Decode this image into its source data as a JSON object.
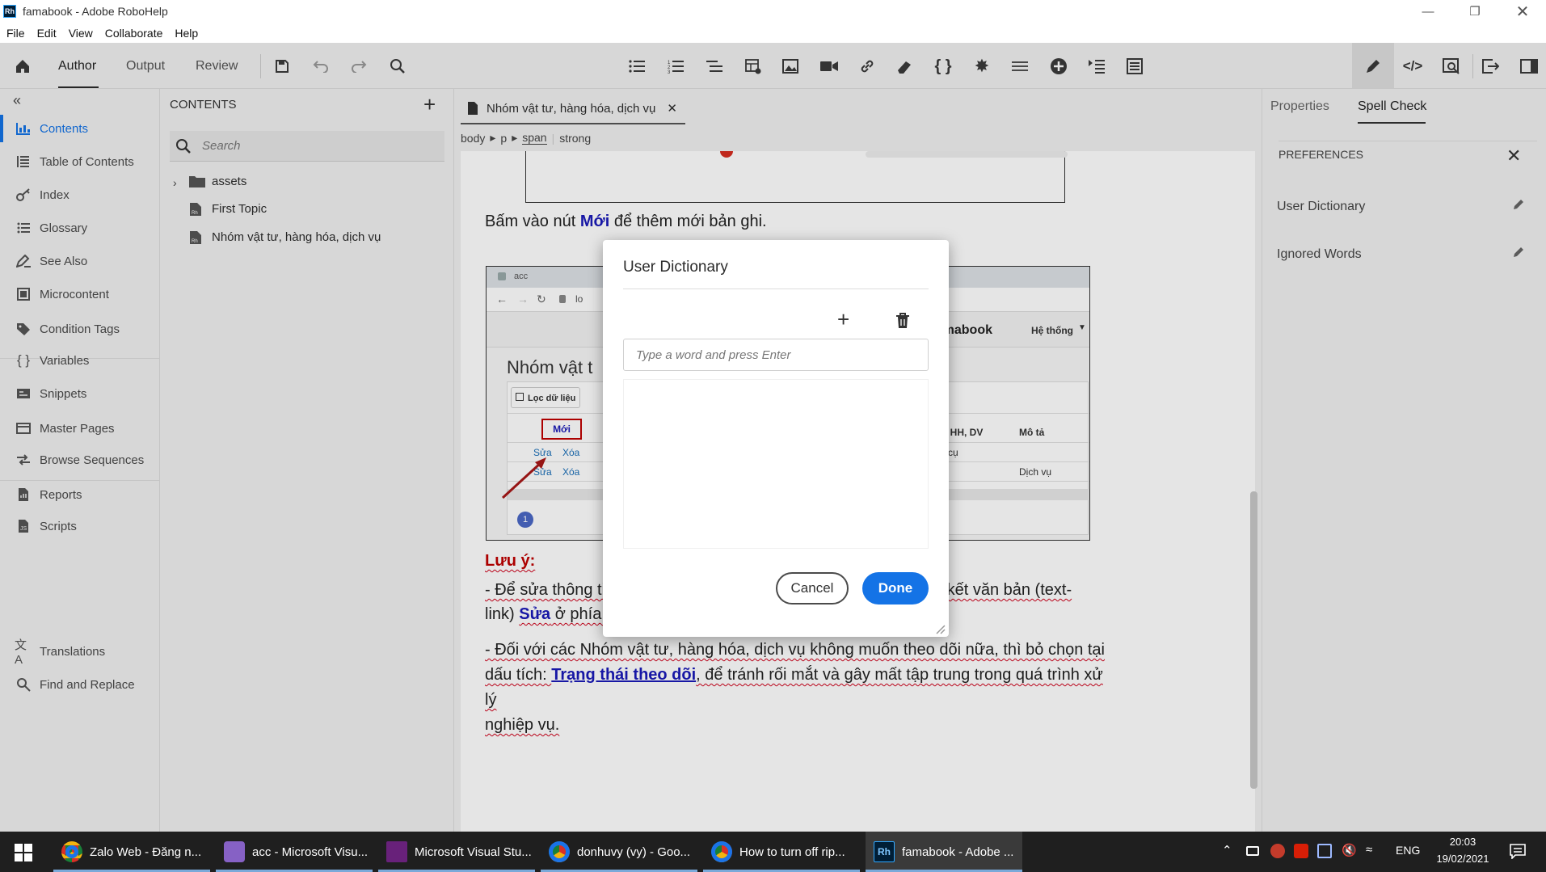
{
  "window": {
    "title": "famabook - Adobe RoboHelp",
    "app_icon": "Rh"
  },
  "menu": [
    "File",
    "Edit",
    "View",
    "Collaborate",
    "Help"
  ],
  "toolbar": {
    "tabs": [
      "Author",
      "Output",
      "Review"
    ],
    "active_tab": "Author"
  },
  "leftnav": {
    "items": [
      {
        "label": "Contents",
        "icon": "contents-icon",
        "active": true
      },
      {
        "label": "Table of Contents",
        "icon": "toc-icon"
      },
      {
        "label": "Index",
        "icon": "key-icon"
      },
      {
        "label": "Glossary",
        "icon": "glossary-icon"
      },
      {
        "label": "See Also",
        "icon": "see-also-icon"
      },
      {
        "label": "Microcontent",
        "icon": "microcontent-icon"
      },
      {
        "label": "Condition Tags",
        "icon": "tag-icon"
      },
      {
        "label": "Variables",
        "icon": "braces-icon"
      },
      {
        "label": "Snippets",
        "icon": "snippets-icon"
      },
      {
        "label": "Master Pages",
        "icon": "master-pages-icon"
      },
      {
        "label": "Browse Sequences",
        "icon": "browse-sequences-icon"
      },
      {
        "label": "Reports",
        "icon": "reports-icon"
      },
      {
        "label": "Scripts",
        "icon": "scripts-icon"
      },
      {
        "label": "Translations",
        "icon": "translate-icon"
      },
      {
        "label": "Find and Replace",
        "icon": "find-replace-icon"
      }
    ]
  },
  "contents": {
    "title": "CONTENTS",
    "search_placeholder": "Search",
    "tree": [
      {
        "label": "assets",
        "type": "folder"
      },
      {
        "label": "First Topic",
        "type": "topic"
      },
      {
        "label": "Nhóm vật tư, hàng hóa, dịch vụ",
        "type": "topic"
      }
    ]
  },
  "editor": {
    "tab_title": "Nhóm vật tư, hàng hóa, dịch vụ",
    "breadcrumb": [
      "body",
      "p",
      "span",
      "strong"
    ],
    "para1_pre": "Bấm vào nút ",
    "para1_bold": "Mới",
    "para1_post": " để thêm mới bản ghi.",
    "note_title": "Lưu ý:",
    "note1_a": "- Để sửa thông tin Nhóm vật tư, hàng hóa, dịch vụ; sử dụng liên kết văn bản (text-",
    "note1_b": "link) ",
    "note1_link": "Sửa",
    "note1_c": " ở phía cạnh trái.",
    "note2_a": "- Đối với các Nhóm vật tư, hàng hóa, dịch vụ không muốn theo dõi nữa, thì bỏ chọn tại",
    "note2_b": "dấu tích: ",
    "note2_link": "Trạng thái theo dõi",
    "note2_c": ", để tránh rối mắt và gây mất tập trung trong quá trình xử lý",
    "note2_d": "nghiệp vụ.",
    "screenshot": {
      "browser_tab": "acc",
      "address": "lo",
      "brand": "famabook",
      "menu": "Hệ thống",
      "page_title": "Nhóm vật t",
      "filter_btn": "Lọc dữ liệu",
      "new_btn": "Mới",
      "col_group": "T, HH, DV",
      "col_desc": "Mô tả",
      "edit": "Sửa",
      "delete": "Xóa",
      "row1_group": "g cụ",
      "row2_desc": "Dịch vụ",
      "page_num": "1"
    }
  },
  "rightpanel": {
    "tabs": [
      "Properties",
      "Spell Check"
    ],
    "active_tab": "Spell Check",
    "section_title": "PREFERENCES",
    "items": [
      "User Dictionary",
      "Ignored Words"
    ]
  },
  "dialog": {
    "title": "User Dictionary",
    "input_placeholder": "Type a word and press Enter",
    "cancel": "Cancel",
    "done": "Done"
  },
  "taskbar": {
    "items": [
      {
        "label": "Zalo Web - Đăng n...",
        "color": "#e8a33d"
      },
      {
        "label": "acc - Microsoft Visu...",
        "color": "#8661c5"
      },
      {
        "label": "Microsoft Visual Stu...",
        "color": "#68217a"
      },
      {
        "label": "donhuvy (vy) - Goo...",
        "color": "#e8a33d"
      },
      {
        "label": "How to turn off rip...",
        "color": "#e8a33d"
      },
      {
        "label": "famabook - Adobe ...",
        "color": "#001e36"
      }
    ],
    "lang": "ENG",
    "time": "20:03",
    "date": "19/02/2021"
  },
  "colors": {
    "accent": "#1473e6",
    "doc_link": "#1a1ab8",
    "note_red": "#c00000",
    "left_active": "#1473e6"
  }
}
